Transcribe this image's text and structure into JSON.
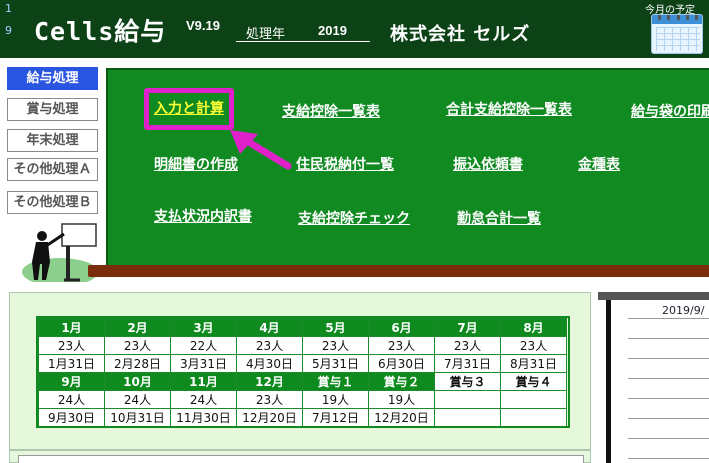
{
  "header": {
    "row_numbers": [
      "1",
      "9"
    ],
    "app_title": "Cells給与",
    "version": "V9.19",
    "year_label": "処理年",
    "year_value": "2019",
    "company": "株式会社 セルズ",
    "schedule_label": "今月の予定",
    "calendar_icon": "calendar-icon"
  },
  "nav": {
    "items": [
      {
        "label": "給与処理",
        "active": true
      },
      {
        "label": "賞与処理",
        "active": false
      },
      {
        "label": "年末処理",
        "active": false
      },
      {
        "label": "その他処理Ａ",
        "active": false
      },
      {
        "label": "その他処理Ｂ",
        "active": false
      }
    ]
  },
  "menu": {
    "items": [
      {
        "label": "入力と計算",
        "highlighted": true
      },
      {
        "label": "支給控除一覧表"
      },
      {
        "label": "合計支給控除一覧表"
      },
      {
        "label": "給与袋の印刷"
      },
      {
        "label": "明細書の作成"
      },
      {
        "label": "住民税納付一覧"
      },
      {
        "label": "振込依頼書"
      },
      {
        "label": "金種表"
      },
      {
        "label": "支払状況内訳書"
      },
      {
        "label": "支給控除チェック"
      },
      {
        "label": "勤怠合計一覧"
      }
    ]
  },
  "calendar": {
    "row1": [
      {
        "month": "1月",
        "count": "23人",
        "date": "1月31日"
      },
      {
        "month": "2月",
        "count": "23人",
        "date": "2月28日"
      },
      {
        "month": "3月",
        "count": "22人",
        "date": "3月31日"
      },
      {
        "month": "4月",
        "count": "23人",
        "date": "4月30日"
      },
      {
        "month": "5月",
        "count": "23人",
        "date": "5月31日"
      },
      {
        "month": "6月",
        "count": "23人",
        "date": "6月30日"
      },
      {
        "month": "7月",
        "count": "23人",
        "date": "7月31日"
      },
      {
        "month": "8月",
        "count": "23人",
        "date": "8月31日"
      }
    ],
    "row2": [
      {
        "month": "9月",
        "count": "24人",
        "date": "9月30日"
      },
      {
        "month": "10月",
        "count": "24人",
        "date": "10月31日"
      },
      {
        "month": "11月",
        "count": "24人",
        "date": "11月30日"
      },
      {
        "month": "12月",
        "count": "23人",
        "date": "12月20日"
      },
      {
        "month": "賞与１",
        "count": "19人",
        "date": "7月12日"
      },
      {
        "month": "賞与２",
        "count": "19人",
        "date": "12月20日"
      },
      {
        "month": "賞与３",
        "count": "",
        "date": ""
      },
      {
        "month": "賞与４",
        "count": "",
        "date": ""
      }
    ]
  },
  "right_panel": {
    "date_fragment": "2019/9/"
  },
  "colors": {
    "header_bg": "#0d4217",
    "board_green": "#128a22",
    "ledge_brown": "#7a2c0d",
    "highlight_pink": "#e020c8",
    "link_yellow": "#ffff33",
    "nav_active": "#2a55e0"
  }
}
